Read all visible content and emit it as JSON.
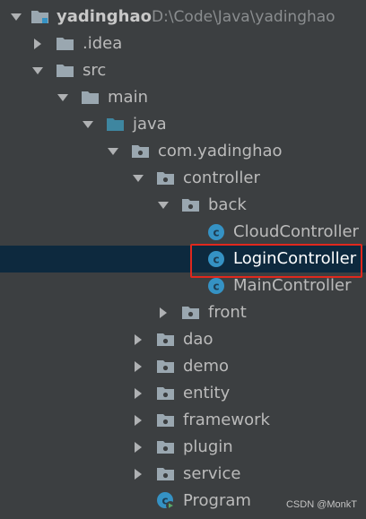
{
  "project": {
    "name": "yadinghao",
    "path": "D:\\Code\\Java\\yadinghao"
  },
  "tree": {
    "idea": ".idea",
    "src": "src",
    "main": "main",
    "java": "java",
    "package": "com.yadinghao",
    "controller": "controller",
    "back": "back",
    "cloud_controller": "CloudController",
    "login_controller": "LoginController",
    "main_controller": "MainController",
    "front": "front",
    "dao": "dao",
    "demo": "demo",
    "entity": "entity",
    "framework": "framework",
    "plugin": "plugin",
    "service": "service",
    "program": "Program"
  },
  "watermark": "CSDN @MonkT",
  "colors": {
    "background": "#3c3f41",
    "selection": "#0d293e",
    "highlight_border": "#e0281d",
    "folder": "#9aa7b0",
    "source_folder": "#3e86a0",
    "class_icon": "#3592c4"
  },
  "selected_item": "LoginController"
}
